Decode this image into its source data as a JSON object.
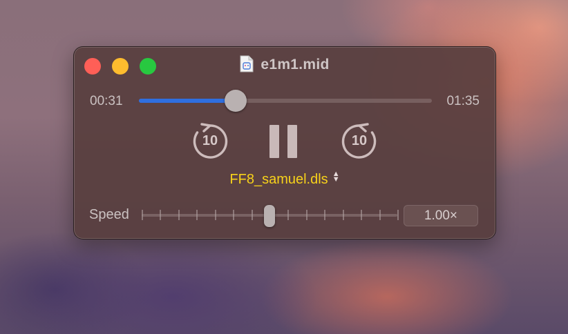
{
  "window": {
    "title": "e1m1.mid",
    "file_icon": "midi-document-icon"
  },
  "playback": {
    "current_time": "00:31",
    "total_time": "01:35",
    "progress_fraction": 0.33,
    "progress_color": "#2f6fe0",
    "state": "playing"
  },
  "controls": {
    "skip_back_label": "10",
    "skip_forward_label": "10",
    "pause_icon": "pause-icon"
  },
  "soundfont": {
    "selected": "FF8_samuel.dls",
    "color": "#f7d21a"
  },
  "speed": {
    "label": "Speed",
    "value_text": "1.00×",
    "tick_count": 15,
    "level_fraction": 0.5
  }
}
